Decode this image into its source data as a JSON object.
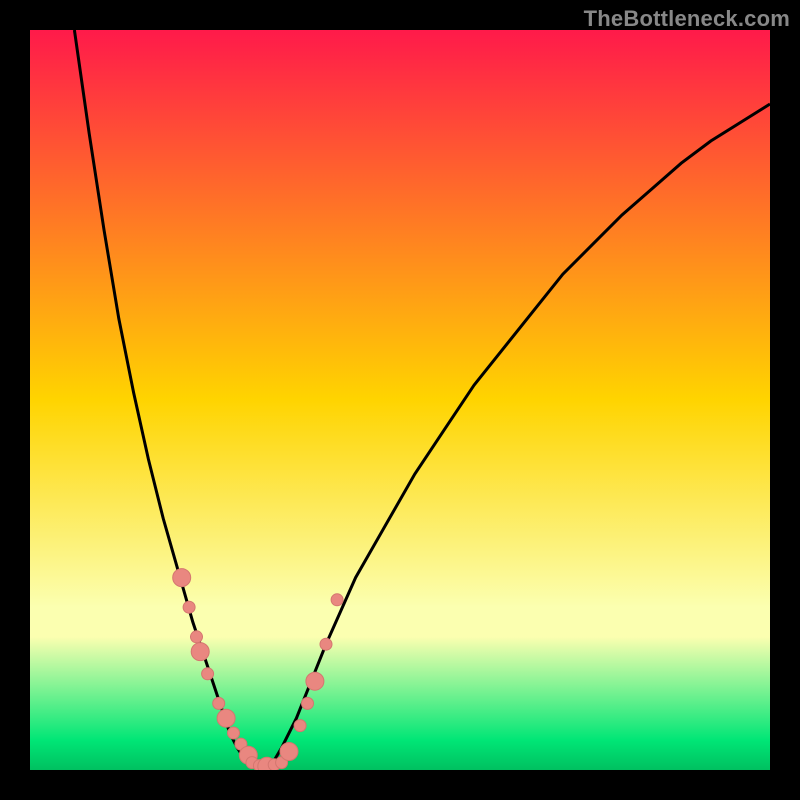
{
  "watermark": "TheBottleneck.com",
  "colors": {
    "bg": "#000000",
    "grad_top": "#ff1a4a",
    "grad_mid": "#ffd400",
    "grad_strip": "#fbffb0",
    "grad_green": "#00e676",
    "curve": "#000000",
    "marker_fill": "#e98780",
    "marker_stroke": "#d4766f"
  },
  "chart_data": {
    "type": "line",
    "title": "",
    "xlabel": "",
    "ylabel": "",
    "xlim": [
      0,
      100
    ],
    "ylim": [
      0,
      100
    ],
    "series": [
      {
        "name": "curve",
        "x": [
          6,
          8,
          10,
          12,
          14,
          16,
          18,
          20,
          22,
          23,
          24,
          25,
          26,
          27,
          28,
          29,
          30,
          31,
          32,
          33,
          34,
          36,
          38,
          40,
          44,
          48,
          52,
          56,
          60,
          64,
          68,
          72,
          76,
          80,
          84,
          88,
          92,
          96,
          100
        ],
        "y": [
          100,
          86,
          73,
          61,
          51,
          42,
          34,
          27,
          20,
          17,
          14,
          11,
          8,
          5,
          3,
          1.5,
          0.7,
          0.3,
          0.5,
          1.3,
          3,
          7,
          12,
          17,
          26,
          33,
          40,
          46,
          52,
          57,
          62,
          67,
          71,
          75,
          78.5,
          82,
          85,
          87.5,
          90
        ]
      }
    ],
    "markers": {
      "name": "points",
      "x": [
        20.5,
        21.5,
        22.5,
        23,
        24,
        25.5,
        26.5,
        27.5,
        28.5,
        29.5,
        30,
        31,
        32,
        33,
        34,
        35,
        36.5,
        37.5,
        38.5,
        40,
        41.5
      ],
      "y": [
        26,
        22,
        18,
        16,
        13,
        9,
        7,
        5,
        3.5,
        2,
        1,
        0.6,
        0.5,
        0.7,
        1,
        2.5,
        6,
        9,
        12,
        17,
        23
      ]
    }
  }
}
